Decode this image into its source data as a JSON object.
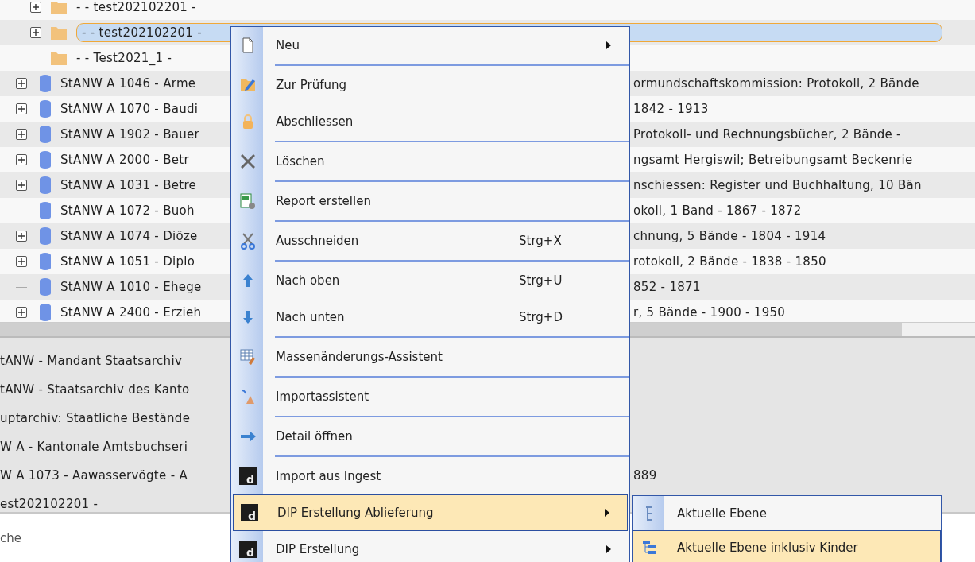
{
  "tree": {
    "child_rows": [
      {
        "label": "- - test202102201 -",
        "expandable": true,
        "selected": false
      },
      {
        "label": "- - test202102201 -",
        "expandable": true,
        "selected": true
      },
      {
        "label": "- - Test2021_1 -",
        "expandable": false,
        "selected": false
      }
    ],
    "rows": [
      {
        "label": "StANW A 1046 - Arme",
        "label_end": "ormundschaftskommission: Protokoll, 2 Bände",
        "expandable": true
      },
      {
        "label": "StANW A 1070 - Baudi",
        "label_end": "1842 - 1913",
        "expandable": true
      },
      {
        "label": "StANW A 1902 - Bauer",
        "label_end": "Protokoll- und Rechnungsbücher, 2 Bände -",
        "expandable": true
      },
      {
        "label": "StANW A 2000 - Betr",
        "label_end": "ngsamt Hergiswil; Betreibungsamt Beckenrie",
        "expandable": true
      },
      {
        "label": "StANW A 1031 - Betre",
        "label_end": "nschiessen: Register und Buchhaltung, 10 Bän",
        "expandable": true
      },
      {
        "label": "StANW A 1072 - Buoh",
        "label_end": "okoll, 1 Band - 1867 - 1872",
        "expandable": false
      },
      {
        "label": "StANW A 1074 - Diöze",
        "label_end": "chnung, 5 Bände - 1804 - 1914",
        "expandable": true
      },
      {
        "label": "StANW A 1051 - Diplo",
        "label_end": "rotokoll, 2 Bände - 1838 - 1850",
        "expandable": true
      },
      {
        "label": "StANW A 1010 - Ehege",
        "label_end": "852 - 1871",
        "expandable": false
      },
      {
        "label": "StANW A 2400 - Erzieh",
        "label_end": "r, 5 Bände - 1900 - 1950",
        "expandable": true
      }
    ]
  },
  "details": [
    {
      "text": "tANW - Mandant Staatsarchiv"
    },
    {
      "text": "tANW - Staatsarchiv des Kanto"
    },
    {
      "text": "uptarchiv: Staatliche Bestände"
    },
    {
      "text": "W A - Kantonale Amtsbuchseri"
    },
    {
      "text": "W A 1073 - Aawasservögte - A",
      "text_end": "889"
    },
    {
      "text": "est202102201 -"
    }
  ],
  "search_text": "che",
  "context_menu": [
    {
      "label": "Neu",
      "kind": "page",
      "submenu": true,
      "separator_after": true,
      "selected": false
    },
    {
      "label": "Zur Prüfung",
      "kind": "edit",
      "submenu": false,
      "separator_after": false,
      "selected": false
    },
    {
      "label": "Abschliessen",
      "kind": "lock",
      "submenu": false,
      "separator_after": true,
      "selected": false
    },
    {
      "label": "Löschen",
      "kind": "delete",
      "submenu": false,
      "separator_after": true,
      "selected": false
    },
    {
      "label": "Report erstellen",
      "kind": "report",
      "submenu": false,
      "separator_after": true,
      "selected": false
    },
    {
      "label": "Ausschneiden",
      "shortcut": "Strg+X",
      "kind": "cut",
      "submenu": false,
      "separator_after": true,
      "selected": false
    },
    {
      "label": "Nach oben",
      "shortcut": "Strg+U",
      "kind": "up",
      "submenu": false,
      "separator_after": false,
      "selected": false
    },
    {
      "label": "Nach unten",
      "shortcut": "Strg+D",
      "kind": "down",
      "submenu": false,
      "separator_after": true,
      "selected": false
    },
    {
      "label": "Massenänderungs-Assistent",
      "kind": "table",
      "submenu": false,
      "separator_after": true,
      "selected": false
    },
    {
      "label": "Importassistent",
      "kind": "wand",
      "submenu": false,
      "separator_after": true,
      "selected": false
    },
    {
      "label": "Detail öffnen",
      "kind": "arrow",
      "submenu": false,
      "separator_after": true,
      "selected": false
    },
    {
      "label": "Import aus Ingest",
      "kind": "letter",
      "icon_letter": "d",
      "submenu": false,
      "separator_after": false,
      "selected": false
    },
    {
      "label": "DIP Erstellung Ablieferung",
      "kind": "letter",
      "icon_letter": "d",
      "submenu": true,
      "separator_after": false,
      "selected": true
    },
    {
      "label": "DIP Erstellung",
      "kind": "letter",
      "icon_letter": "d",
      "submenu": true,
      "separator_after": false,
      "selected": false
    }
  ],
  "submenu": [
    {
      "label": "Aktuelle Ebene",
      "kind": "level",
      "selected": false
    },
    {
      "label": "Aktuelle Ebene inklusiv Kinder",
      "kind": "tree",
      "selected": true
    }
  ]
}
